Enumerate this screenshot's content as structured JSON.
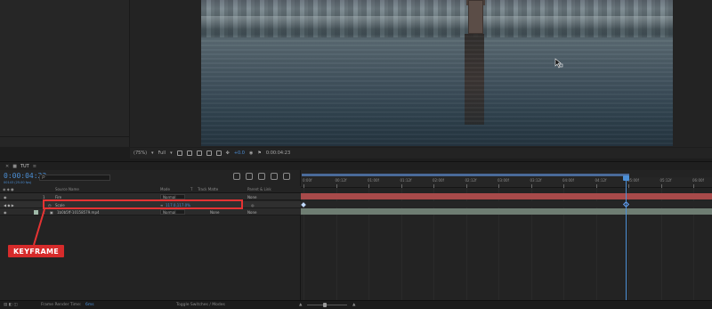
{
  "viewer": {
    "footage_desc": "",
    "toolbar": {
      "zoom": "(75%)",
      "quality": "Full",
      "exposure": "+0.0",
      "timecode": "0:00:04:23"
    }
  },
  "comp": {
    "tab_label": "TUT",
    "timecode": "0:00:04:23",
    "fps": "00143 (25.00 fps)",
    "search_placeholder": "ρ·"
  },
  "columns": {
    "source_name": "Source Name",
    "mode": "Mode",
    "t": "T",
    "track_matte": "Track Matte",
    "parent": "Parent & Link"
  },
  "layers": [
    {
      "num": "1",
      "name": "Fire",
      "mode": "Normal",
      "parent": "None"
    },
    {
      "num": "",
      "name": "Scale",
      "value": "117.0,117.0%",
      "parent": ""
    },
    {
      "num": "2",
      "name": "1b0b5ff-10158579.mp4",
      "mode": "Normal",
      "track": "None",
      "parent": "None"
    }
  ],
  "ruler_ticks": [
    "0:00f",
    "00:12f",
    "01:00f",
    "01:12f",
    "02:00f",
    "02:12f",
    "03:00f",
    "03:12f",
    "04:00f",
    "04:12f",
    "05:00f",
    "05:12f",
    "06:00f"
  ],
  "annotation": {
    "label": "KEYFRAME"
  },
  "status": {
    "render_label": "Frame Render Time:",
    "render_value": "6ms",
    "toggle": "Toggle Switches / Modes"
  },
  "colors": {
    "accent_blue": "#4c8fd6",
    "annotation_red": "#e53333",
    "layer1_track": "#a84a4a",
    "layer2_track": "#6e7d72"
  }
}
